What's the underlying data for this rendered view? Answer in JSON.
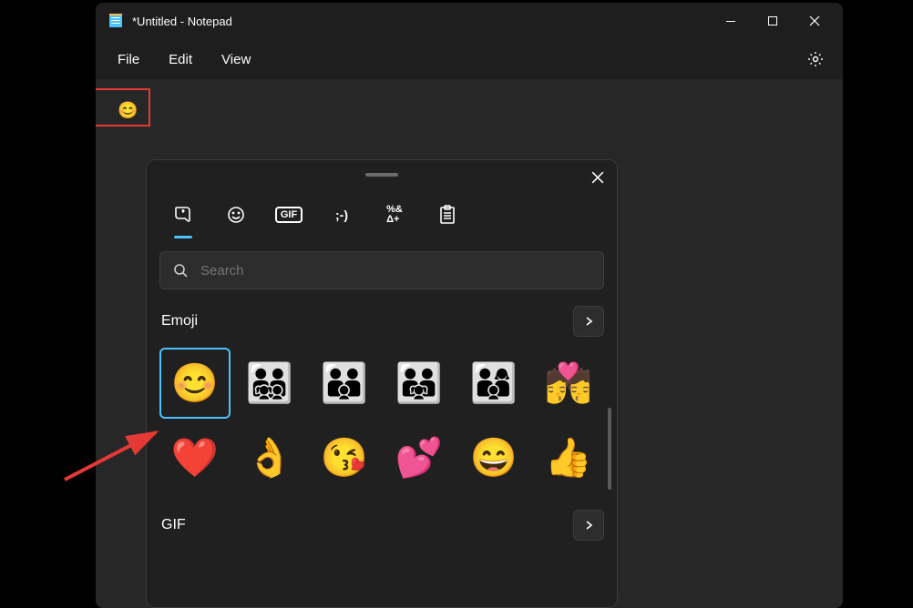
{
  "window": {
    "title": "*Untitled - Notepad"
  },
  "menu": {
    "file": "File",
    "edit": "Edit",
    "view": "View"
  },
  "editor": {
    "content_emoji": "😊"
  },
  "picker": {
    "tabs": {
      "gif_label": "GIF",
      "kaomoji_label": ";-)",
      "symbols_label": "%&\nΔ+"
    },
    "search_placeholder": "Search",
    "section_emoji": "Emoji",
    "section_gif": "GIF",
    "emojis_row1": [
      "😊",
      "👨‍👨‍👧‍👦",
      "👨‍👨‍👦",
      "👨‍👨‍👧",
      "👨‍👩‍👦",
      "💏"
    ],
    "emojis_row2": [
      "❤️",
      "👌",
      "😘",
      "💕",
      "😄",
      "👍"
    ]
  }
}
